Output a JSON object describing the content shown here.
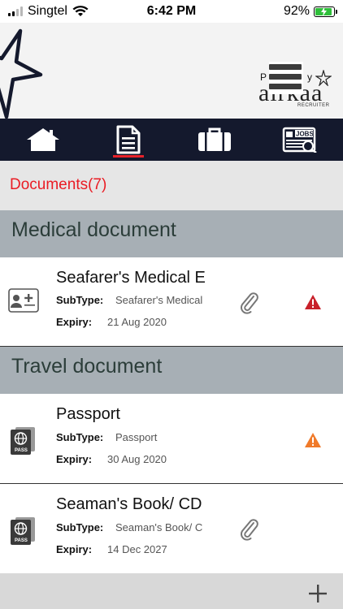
{
  "status_bar": {
    "carrier": "Singtel",
    "time": "6:42 PM",
    "battery": "92%",
    "battery_level": 0.92
  },
  "header": {
    "brand_powered": "P",
    "brand_by": "y",
    "brand_name": "airkaa",
    "brand_tagline": "RECRUITER"
  },
  "nav": {
    "items": [
      {
        "icon": "home-icon",
        "active": false
      },
      {
        "icon": "document-icon",
        "active": true
      },
      {
        "icon": "briefcase-icon",
        "active": false
      },
      {
        "icon": "jobs-icon",
        "label": "JOBS",
        "active": false
      }
    ]
  },
  "documents_count_label": "Documents(7)",
  "sections": [
    {
      "title": "Medical document",
      "items": [
        {
          "title": "Seafarer's Medical E",
          "subtype_label": "SubType:",
          "subtype_value": "Seafarer's Medical",
          "expiry_label": "Expiry:",
          "expiry_value": "21 Aug 2020",
          "icon": "medical-card-icon",
          "has_attachment": true,
          "warning": true,
          "warning_color": "#c8202a"
        }
      ]
    },
    {
      "title": "Travel document",
      "items": [
        {
          "title": "Passport",
          "subtype_label": "SubType:",
          "subtype_value": "Passport",
          "expiry_label": "Expiry:",
          "expiry_value": "30 Aug 2020",
          "icon": "passport-icon",
          "has_attachment": false,
          "warning": true,
          "warning_color": "#f07a2a"
        },
        {
          "title": "Seaman's Book/ CD",
          "subtype_label": "SubType:",
          "subtype_value": "Seaman's Book/ C",
          "expiry_label": "Expiry:",
          "expiry_value": "14 Dec 2027",
          "icon": "passport-icon",
          "has_attachment": true,
          "warning": false
        }
      ]
    }
  ],
  "colors": {
    "nav_bg": "#14192d",
    "accent_red": "#ea1c24",
    "section_bg": "#a7afb5",
    "section_text": "#2b3d39"
  }
}
